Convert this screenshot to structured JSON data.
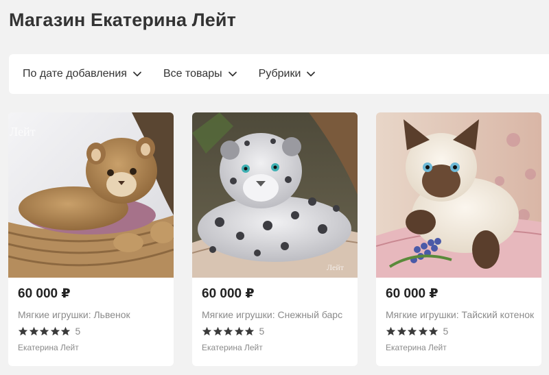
{
  "shop": {
    "title": "Магазин Екатерина Лейт"
  },
  "filters": [
    {
      "label": "По дате добавления",
      "icon": "chevron-down-icon"
    },
    {
      "label": "Все товары",
      "icon": "chevron-down-icon"
    },
    {
      "label": "Рубрики",
      "icon": "chevron-down-icon"
    }
  ],
  "products": [
    {
      "price": "60 000 ₽",
      "name": "Мягкие игрушки: Львенок",
      "rating": 5,
      "rating_count": "5",
      "seller": "Екатерина Лейт",
      "watermark": "Лейт"
    },
    {
      "price": "60 000 ₽",
      "name": "Мягкие игрушки: Снежный барс",
      "rating": 5,
      "rating_count": "5",
      "seller": "Екатерина Лейт",
      "watermark": "Лейт"
    },
    {
      "price": "60 000 ₽",
      "name": "Мягкие игрушки: Тайский котенок",
      "rating": 5,
      "rating_count": "5",
      "seller": "Екатерина Лейт"
    }
  ],
  "colors": {
    "page_bg": "#f2f2f2",
    "card_bg": "#ffffff",
    "text_dark": "#333333",
    "text_muted": "#8a8a8a",
    "star": "#3a3a3a"
  }
}
